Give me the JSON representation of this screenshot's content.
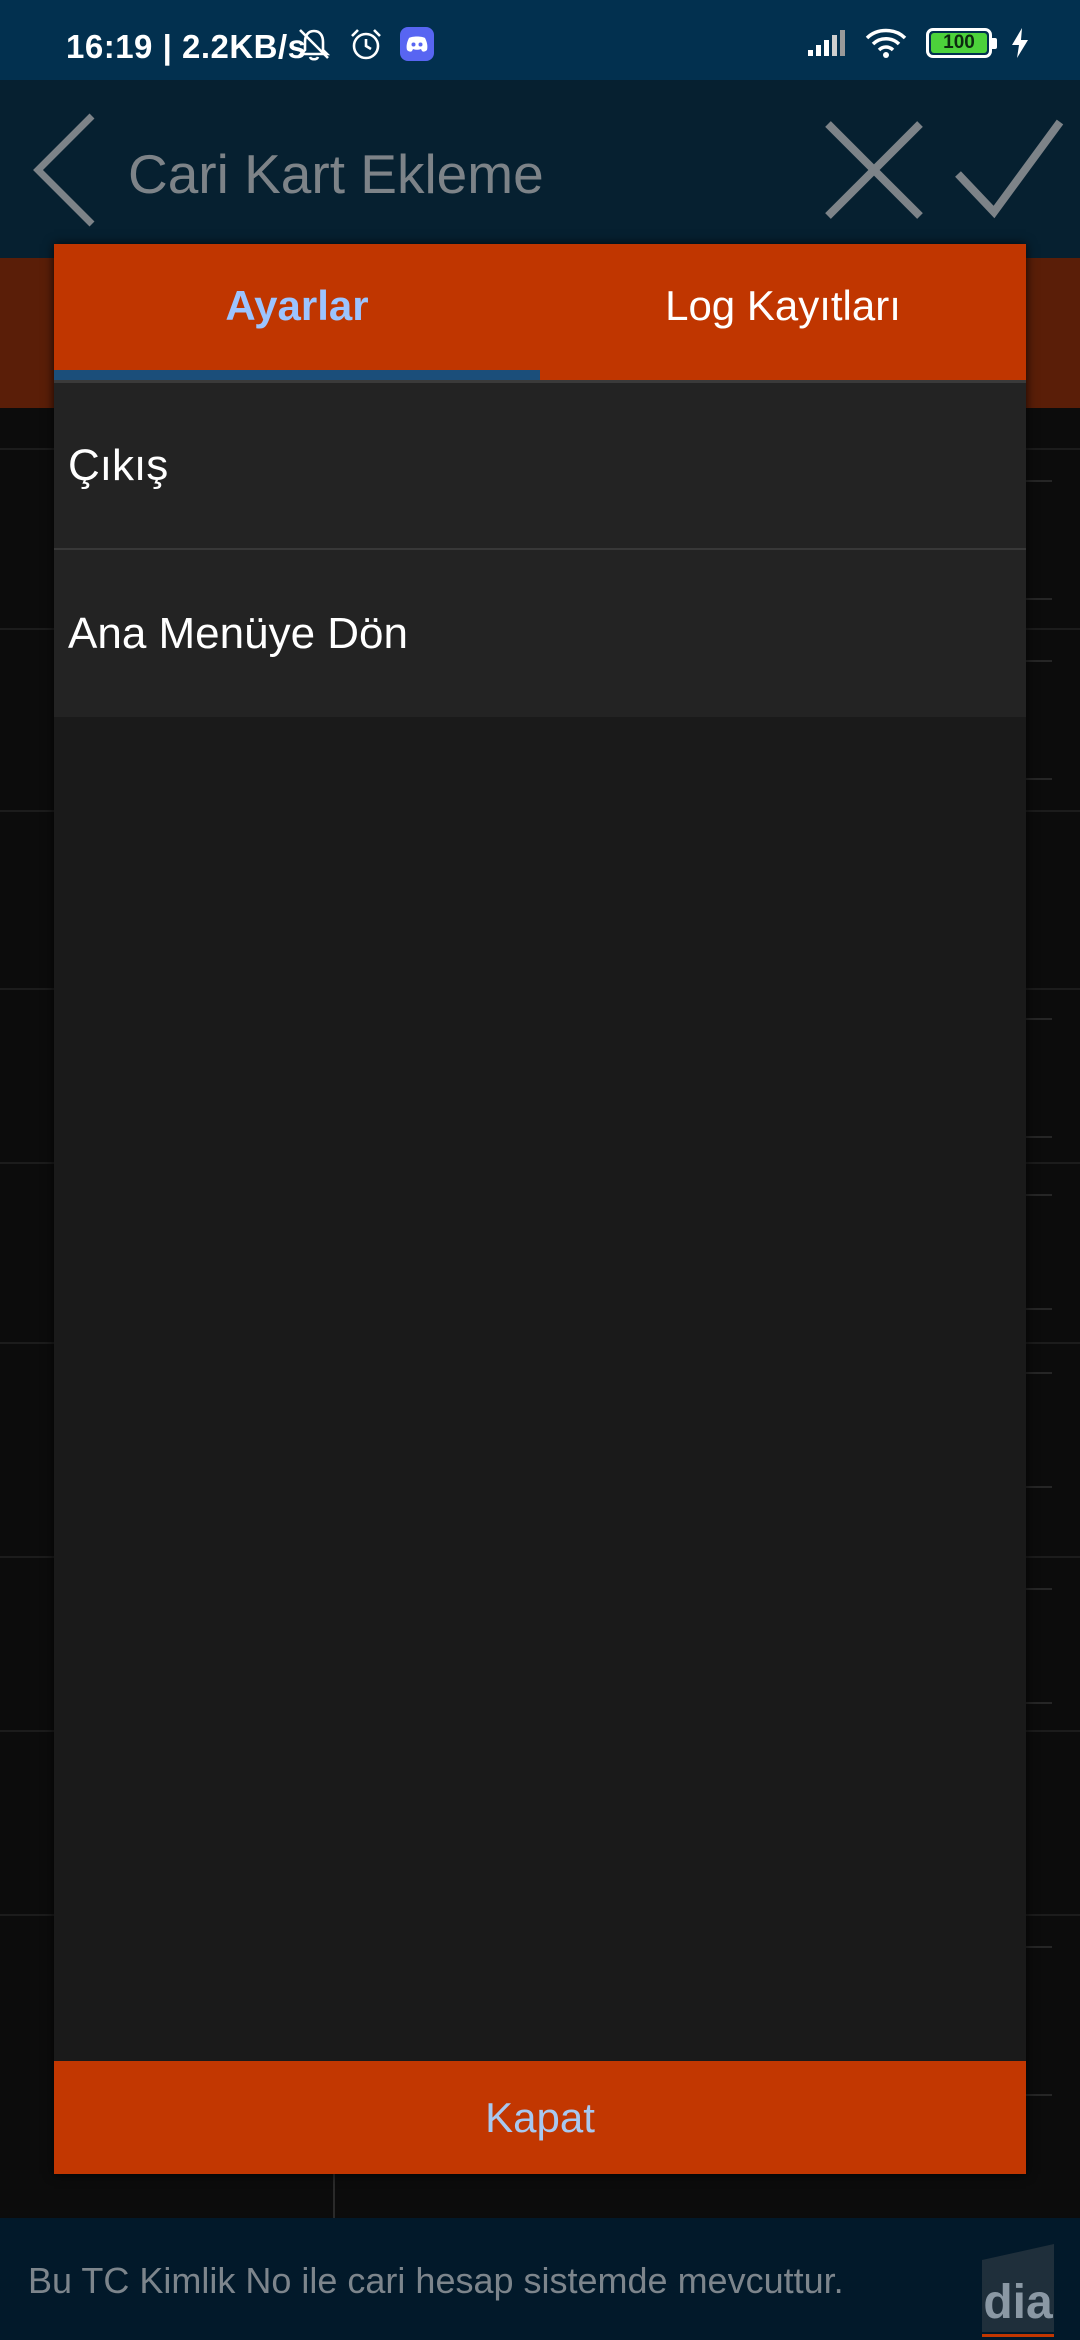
{
  "status_bar": {
    "time": "16:19 | 2.2KB/s",
    "battery": "100",
    "icons_left": [
      "bell-muted-icon",
      "alarm-icon",
      "discord-icon"
    ],
    "icons_right": [
      "signal-icon",
      "wifi-icon",
      "battery-icon",
      "charging-icon"
    ]
  },
  "app_bar": {
    "title": "Cari Kart Ekleme",
    "back_icon": "chevron-left-icon",
    "cancel_icon": "close-icon",
    "confirm_icon": "check-icon"
  },
  "dialog": {
    "tabs": [
      {
        "label": "Ayarlar",
        "selected": true
      },
      {
        "label": "Log Kayıtları",
        "selected": false
      }
    ],
    "menu_items": [
      {
        "label": "Çıkış"
      },
      {
        "label": "Ana Menüye Dön"
      }
    ],
    "close_label": "Kapat"
  },
  "footer": {
    "message": "Bu TC Kimlik No ile cari hesap sistemde mevcuttur.",
    "logo_text": "dia"
  },
  "colors": {
    "accent_orange": "#c23701",
    "tab_indicator": "#1b4e7a",
    "selected_tab_text": "#9cc4ff",
    "status_bar": "#02304f",
    "app_bar": "#062030"
  }
}
